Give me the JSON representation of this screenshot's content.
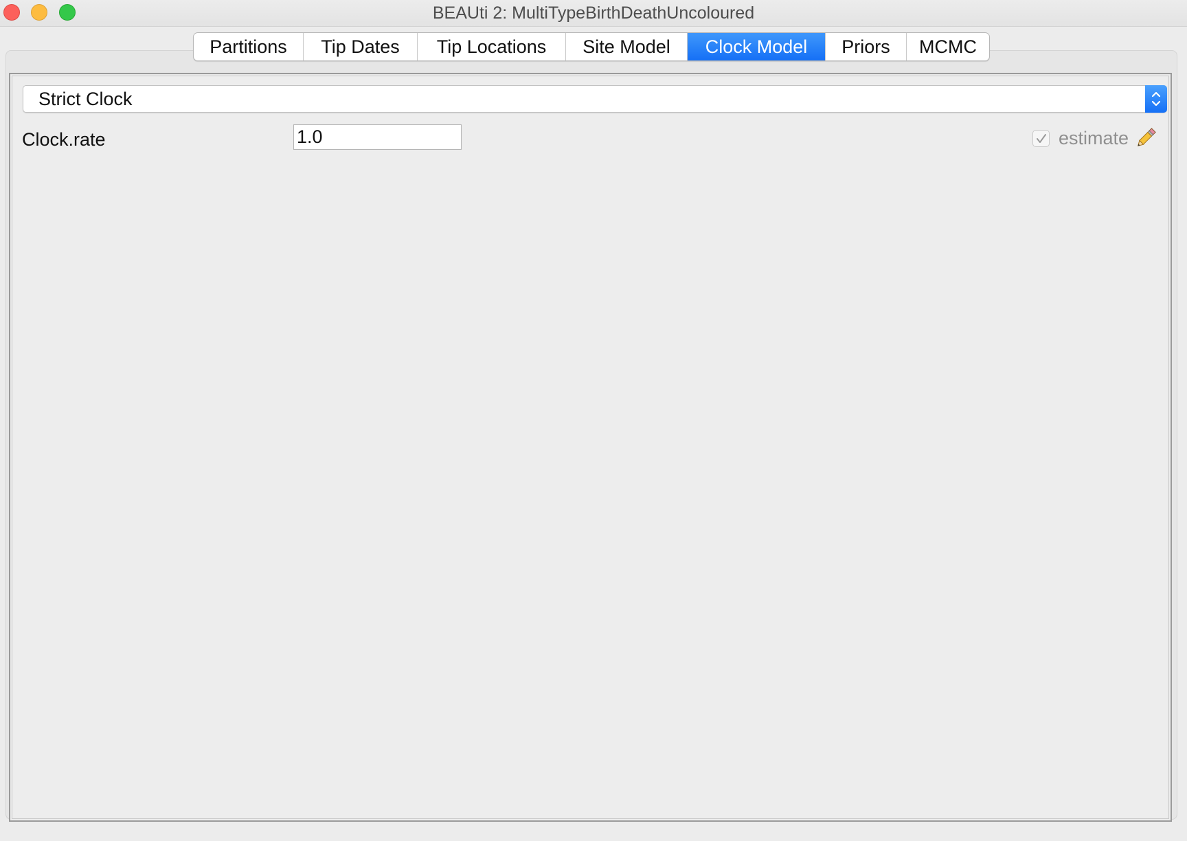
{
  "window": {
    "title": "BEAUti 2: MultiTypeBirthDeathUncoloured"
  },
  "tabs": [
    {
      "label": "Partitions",
      "active": false
    },
    {
      "label": "Tip Dates",
      "active": false
    },
    {
      "label": "Tip Locations",
      "active": false
    },
    {
      "label": "Site Model",
      "active": false
    },
    {
      "label": "Clock Model",
      "active": true
    },
    {
      "label": "Priors",
      "active": false
    },
    {
      "label": "MCMC",
      "active": false
    }
  ],
  "clock_model": {
    "selected": "Strict Clock",
    "parameter": {
      "label": "Clock.rate",
      "value": "1.0",
      "estimate_label": "estimate",
      "estimate_checked": true,
      "estimate_enabled": false
    }
  },
  "icons": {
    "close": "close-window-icon",
    "minimize": "minimize-window-icon",
    "maximize": "zoom-window-icon",
    "combo_arrows": "updown-chevron-icon",
    "checkbox": "checkmark-icon",
    "edit": "pencil-icon"
  },
  "colors": {
    "accent": "#1a74f7",
    "background": "#ececec",
    "close": "#fc605b",
    "minimize": "#fdbc40",
    "maximize": "#34c84a"
  }
}
